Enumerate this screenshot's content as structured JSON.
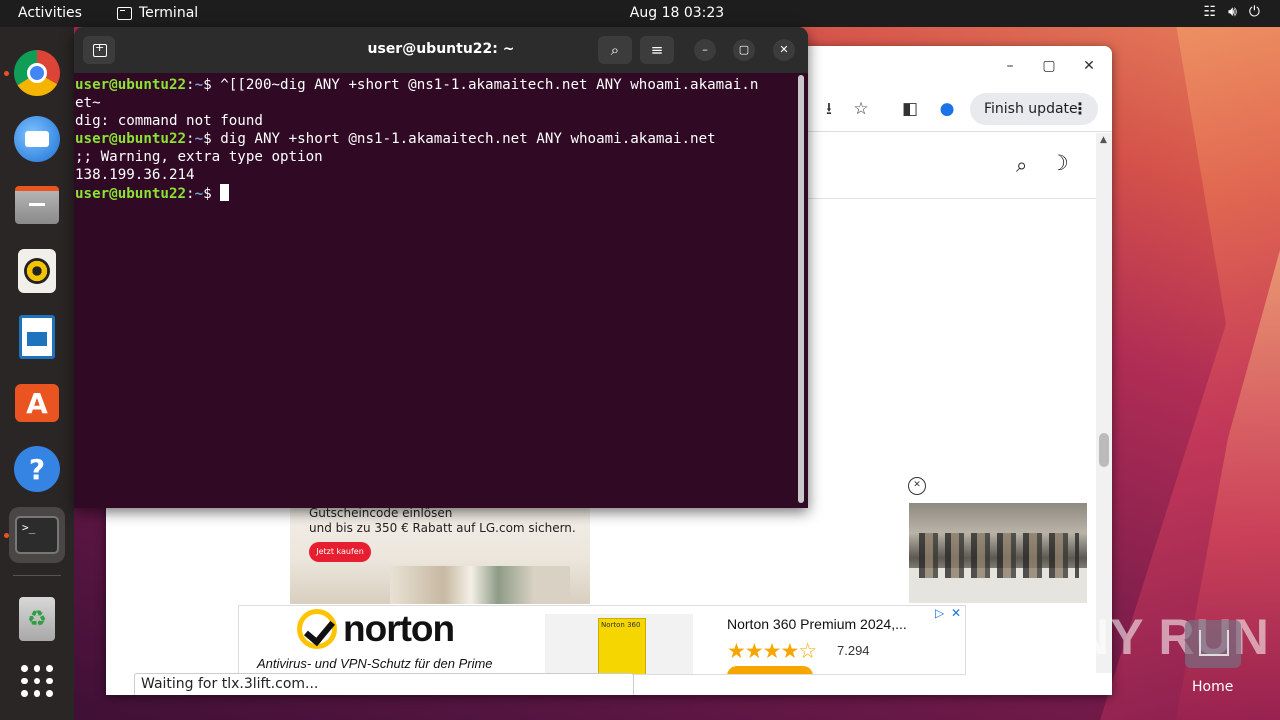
{
  "topbar": {
    "activities": "Activities",
    "app_name": "Terminal",
    "clock": "Aug 18  03:23",
    "tray_icons": [
      "network-icon",
      "volume-icon",
      "power-icon"
    ]
  },
  "dock": {
    "items": [
      "chrome",
      "thunderbird",
      "files",
      "rhythmbox",
      "libreoffice-writer",
      "app-center",
      "help",
      "terminal",
      "trash",
      "show-apps"
    ]
  },
  "terminal": {
    "title": "user@ubuntu22: ~",
    "lines": [
      {
        "user": "user@ubuntu22",
        "sep": ":",
        "path": "~",
        "dollar": "$ ",
        "cmd": "^[[200~dig ANY +short @ns1-1.akamaitech.net ANY whoami.akamai.n"
      },
      {
        "text": "et~"
      },
      {
        "text": "dig: command not found"
      },
      {
        "user": "user@ubuntu22",
        "sep": ":",
        "path": "~",
        "dollar": "$ ",
        "cmd": "dig ANY +short @ns1-1.akamaitech.net ANY whoami.akamai.net"
      },
      {
        "text": ";; Warning, extra type option"
      },
      {
        "text": "138.199.36.214"
      },
      {
        "user": "user@ubuntu22",
        "sep": ":",
        "path": "~",
        "dollar": "$ ",
        "cmd": ""
      }
    ]
  },
  "browser": {
    "finish_update": "Finish update",
    "status": "Waiting for tlx.3lift.com...",
    "ad_lg": {
      "line1": "Gutscheincode einlösen",
      "line2": "und bis zu 350 € Rabatt auf LG.com sichern.",
      "button": "Jetzt kaufen"
    },
    "ad_norton": {
      "brand": "norton",
      "subtitle": "Antivirus- und VPN-Schutz für den Prime",
      "product_title": "Norton 360 Premium 2024,...",
      "stars": "★★★★☆",
      "rating": "7.294",
      "box_label": "Norton 360"
    }
  },
  "desktop": {
    "home_label": "Home",
    "watermark": "ANY RUN"
  }
}
